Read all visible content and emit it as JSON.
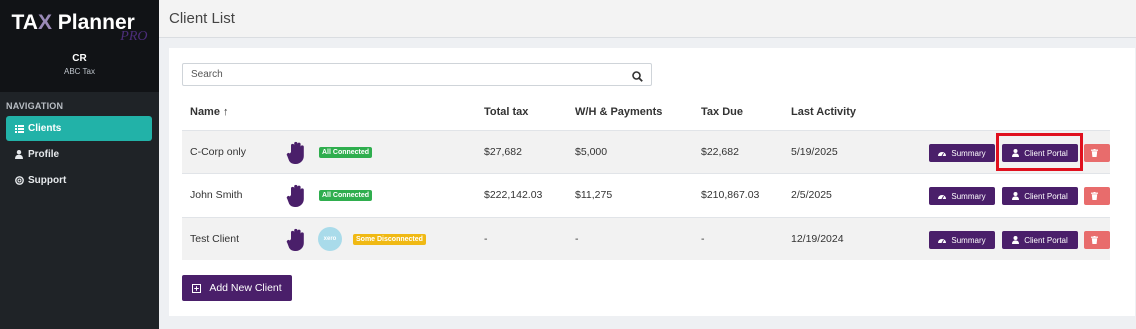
{
  "brand": {
    "logo_main_pre": "TA",
    "logo_main_x": "X",
    "logo_main_post": " Planner",
    "logo_sub": "PRO",
    "user_initials": "CR",
    "user_org": "ABC Tax"
  },
  "nav": {
    "heading": "NAVIGATION",
    "items": [
      {
        "label": "Clients",
        "icon": "list-icon",
        "active": true
      },
      {
        "label": "Profile",
        "icon": "user-icon",
        "active": false
      },
      {
        "label": "Support",
        "icon": "lifebuoy-icon",
        "active": false
      }
    ]
  },
  "page": {
    "title": "Client List"
  },
  "search": {
    "placeholder": "Search",
    "value": ""
  },
  "table": {
    "headers": [
      "Name ↑",
      "Total tax",
      "W/H & Payments",
      "Tax Due",
      "Last Activity"
    ],
    "rows": [
      {
        "name": "C-Corp only",
        "status": "All Connected",
        "status_color": "#2fae4e",
        "xero": false,
        "total_tax": "$27,682",
        "payments": "$5,000",
        "tax_due": "$22,682",
        "last_activity": "5/19/2025"
      },
      {
        "name": "John Smith",
        "status": "All Connected",
        "status_color": "#2fae4e",
        "xero": false,
        "total_tax": "$222,142.03",
        "payments": "$11,275",
        "tax_due": "$210,867.03",
        "last_activity": "2/5/2025"
      },
      {
        "name": "Test Client",
        "status": "Some Disconnected",
        "status_color": "#f0b914",
        "xero": true,
        "xero_label": "xero",
        "total_tax": "-",
        "payments": "-",
        "tax_due": "-",
        "last_activity": "12/19/2024"
      }
    ],
    "actions": {
      "summary_label": "Summary",
      "portal_label": "Client Portal"
    }
  },
  "add_button": {
    "label": "Add New Client"
  },
  "colors": {
    "primary": "#4a1f6a",
    "accent": "#22b2a8",
    "danger": "#e86c6c",
    "highlight": "#e0101e"
  }
}
